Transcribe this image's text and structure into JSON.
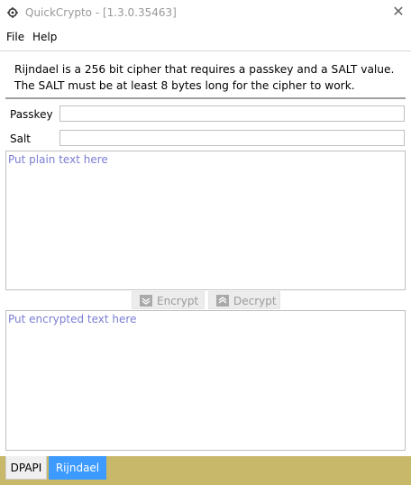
{
  "window": {
    "title": "QuickCrypto - [1.3.0.35463]",
    "close_glyph": "✕",
    "icon": "app-gear-icon"
  },
  "menu": {
    "items": [
      "File",
      "Help"
    ]
  },
  "rijndael": {
    "description": "Rijndael is a 256 bit cipher that requires a passkey and a SALT value. The SALT must be at least 8 bytes long for the cipher to work.",
    "passkey_label": "Passkey",
    "salt_label": "Salt",
    "plain_placeholder": "Put plain text here",
    "encrypted_placeholder": "Put encrypted text here",
    "encrypt_label": "Encrypt",
    "decrypt_label": "Decrypt"
  },
  "tabs": [
    {
      "label": "DPAPI",
      "active": false
    },
    {
      "label": "Rijndael",
      "active": true
    }
  ],
  "colors": {
    "placeholder": "#7a7ed2",
    "tab_active": "#3d9aff",
    "tabbar": "#c8b86a"
  }
}
